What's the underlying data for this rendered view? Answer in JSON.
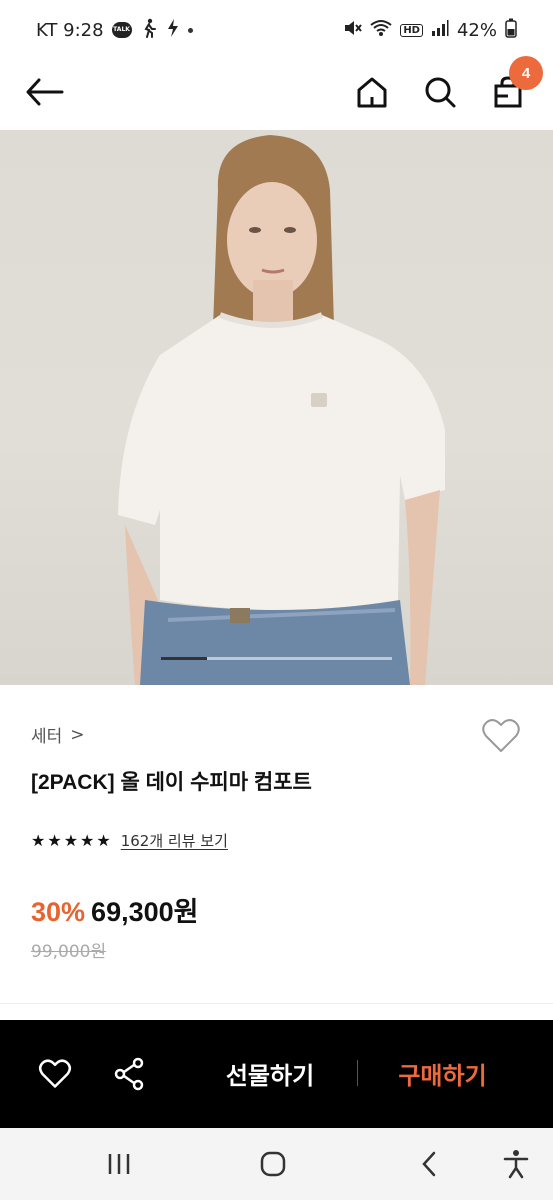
{
  "status_bar": {
    "carrier_time": "KT 9:28",
    "talk_badge": "TALK",
    "battery": "42%",
    "hd_label": "HD"
  },
  "header": {
    "cart_count": "4",
    "icons": [
      "back-arrow-icon",
      "home-icon",
      "search-icon",
      "shopping-bag-icon"
    ]
  },
  "carousel": {
    "current_index": 1,
    "progress_fraction": 0.2
  },
  "product": {
    "category": "세터",
    "category_chevron": ">",
    "title": "[2PACK] 올 데이 수피마 컴포트",
    "rating_stars": 5,
    "review_link": "162개 리뷰 보기",
    "discount": "30%",
    "price": "69,300원",
    "original_price": "99,000원"
  },
  "actions": {
    "gift_label": "선물하기",
    "buy_label": "구매하기"
  },
  "colors": {
    "accent": "#ec6a3c",
    "discount": "#e8632e",
    "action_bar_bg": "#000000"
  }
}
